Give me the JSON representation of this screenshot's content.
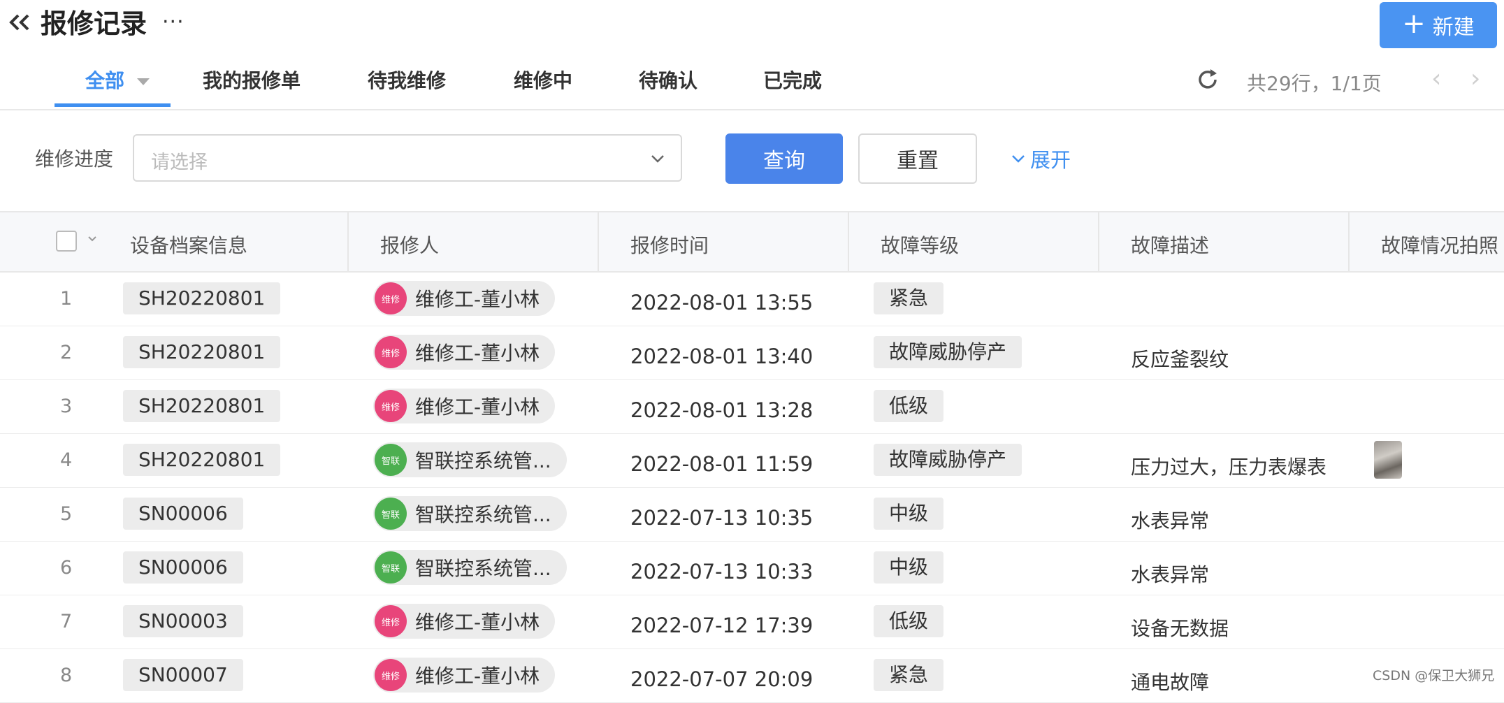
{
  "header": {
    "title": "报修记录",
    "more_label": "···",
    "new_button_plus": "+",
    "new_button_label": "新建"
  },
  "tabs": [
    {
      "label": "全部",
      "active": true
    },
    {
      "label": "我的报修单",
      "active": false
    },
    {
      "label": "待我维修",
      "active": false
    },
    {
      "label": "维修中",
      "active": false
    },
    {
      "label": "待确认",
      "active": false
    },
    {
      "label": "已完成",
      "active": false
    }
  ],
  "pager": {
    "info": "共29行，1/1页",
    "prev": "‹",
    "next": "›"
  },
  "filter": {
    "label": "维修进度",
    "placeholder": "请选择",
    "query_label": "查询",
    "reset_label": "重置",
    "expand_label": "展开"
  },
  "table": {
    "columns": [
      "设备档案信息",
      "报修人",
      "报修时间",
      "故障等级",
      "故障描述",
      "故障情况拍照"
    ],
    "rows": [
      {
        "index": "1",
        "code": "SH20220801",
        "avatar": "维修",
        "avatar_color": "#e8457a",
        "user": "维修工-董小林",
        "time": "2022-08-01 13:55",
        "level": "紧急",
        "desc": "",
        "photo": false
      },
      {
        "index": "2",
        "code": "SH20220801",
        "avatar": "维修",
        "avatar_color": "#e8457a",
        "user": "维修工-董小林",
        "time": "2022-08-01 13:40",
        "level": "故障威胁停产",
        "desc": "反应釜裂纹",
        "photo": false
      },
      {
        "index": "3",
        "code": "SH20220801",
        "avatar": "维修",
        "avatar_color": "#e8457a",
        "user": "维修工-董小林",
        "time": "2022-08-01 13:28",
        "level": "低级",
        "desc": "",
        "photo": false
      },
      {
        "index": "4",
        "code": "SH20220801",
        "avatar": "智联",
        "avatar_color": "#4caf50",
        "user": "智联控系统管...",
        "time": "2022-08-01 11:59",
        "level": "故障威胁停产",
        "desc": "压力过大，压力表爆表",
        "photo": true
      },
      {
        "index": "5",
        "code": "SN00006",
        "avatar": "智联",
        "avatar_color": "#4caf50",
        "user": "智联控系统管...",
        "time": "2022-07-13 10:35",
        "level": "中级",
        "desc": "水表异常",
        "photo": false
      },
      {
        "index": "6",
        "code": "SN00006",
        "avatar": "智联",
        "avatar_color": "#4caf50",
        "user": "智联控系统管...",
        "time": "2022-07-13 10:33",
        "level": "中级",
        "desc": "水表异常",
        "photo": false
      },
      {
        "index": "7",
        "code": "SN00003",
        "avatar": "维修",
        "avatar_color": "#e8457a",
        "user": "维修工-董小林",
        "time": "2022-07-12 17:39",
        "level": "低级",
        "desc": "设备无数据",
        "photo": false
      },
      {
        "index": "8",
        "code": "SN00007",
        "avatar": "维修",
        "avatar_color": "#e8457a",
        "user": "维修工-董小林",
        "time": "2022-07-07 20:09",
        "level": "紧急",
        "desc": "通电故障",
        "photo": false
      }
    ]
  },
  "watermark": "CSDN @保卫大狮兄",
  "colors": {
    "accent": "#3f8ff0",
    "primary_button": "#4a84ea",
    "tag_bg": "#ececec"
  }
}
